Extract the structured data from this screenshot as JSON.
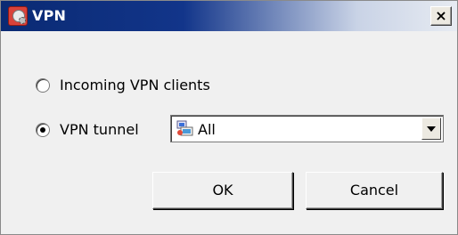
{
  "window": {
    "title": "VPN",
    "close_label": "×"
  },
  "options": {
    "incoming_label": "Incoming VPN clients",
    "incoming_selected": false,
    "tunnel_label": "VPN tunnel",
    "tunnel_selected": true
  },
  "tunnel_select": {
    "value": "All",
    "icon": "network-objects-icon"
  },
  "buttons": {
    "ok_label": "OK",
    "cancel_label": "Cancel"
  },
  "colors": {
    "titlebar_start": "#0a2a73",
    "titlebar_end": "#e7ebf2",
    "dialog_bg": "#f0f0f0"
  }
}
